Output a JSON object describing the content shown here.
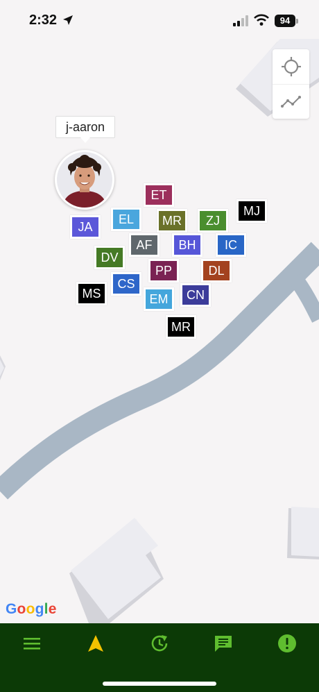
{
  "status_bar": {
    "time": "2:32",
    "battery": "94",
    "icons": [
      "location-arrow-icon",
      "signal-icon",
      "wifi-icon",
      "battery-icon"
    ]
  },
  "map_controls": {
    "icons": [
      "crosshair-icon",
      "route-icon"
    ]
  },
  "user": {
    "tooltip": "j-aaron",
    "avatar_icon": "person-avatar"
  },
  "markers": [
    {
      "label": "ET",
      "color": "#9c2f5c"
    },
    {
      "label": "MJ",
      "color": "#000000"
    },
    {
      "label": "EL",
      "color": "#4aa6dd"
    },
    {
      "label": "MR",
      "color": "#6a7129"
    },
    {
      "label": "ZJ",
      "color": "#4a8e2e"
    },
    {
      "label": "JA",
      "color": "#5b57d9"
    },
    {
      "label": "AF",
      "color": "#5f676c"
    },
    {
      "label": "BH",
      "color": "#5656d8"
    },
    {
      "label": "IC",
      "color": "#2966c6"
    },
    {
      "label": "DV",
      "color": "#457a25"
    },
    {
      "label": "PP",
      "color": "#7a2253"
    },
    {
      "label": "DL",
      "color": "#a3421f"
    },
    {
      "label": "MS",
      "color": "#000000"
    },
    {
      "label": "CS",
      "color": "#2e66c9"
    },
    {
      "label": "EM",
      "color": "#44a6dc"
    },
    {
      "label": "CN",
      "color": "#3c3c9a"
    },
    {
      "label": "MR",
      "color": "#000000"
    }
  ],
  "map": {
    "attribution": "Google",
    "road_color": "#a9b7c5",
    "background_color": "#f6f4f5"
  },
  "bottom_nav": {
    "background": "#0c3a06",
    "accent": "#5fbd2f",
    "active_color": "#f3c200",
    "items": [
      "menu-icon",
      "navigate-icon",
      "history-icon",
      "chat-icon",
      "alert-icon"
    ]
  }
}
